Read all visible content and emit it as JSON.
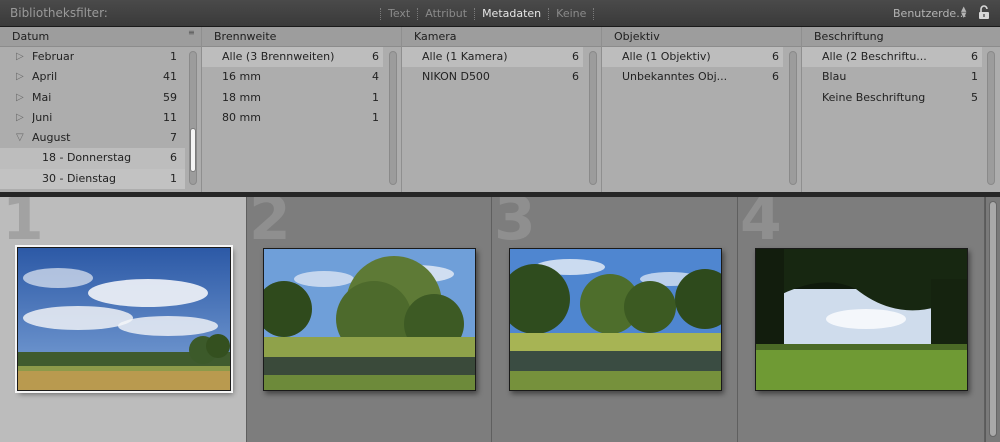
{
  "filterbar": {
    "title": "Bibliotheksfilter:",
    "modes": [
      {
        "label": "Text",
        "active": false
      },
      {
        "label": "Attribut",
        "active": false
      },
      {
        "label": "Metadaten",
        "active": true
      },
      {
        "label": "Keine",
        "active": false
      }
    ],
    "preset": "Benutzerde...",
    "lock_icon": "padlock-open-icon"
  },
  "columns": [
    {
      "header": "Datum",
      "rows": [
        {
          "label": "Februar",
          "count": "1",
          "expander": "collapsed"
        },
        {
          "label": "April",
          "count": "41",
          "expander": "collapsed"
        },
        {
          "label": "Mai",
          "count": "59",
          "expander": "collapsed"
        },
        {
          "label": "Juni",
          "count": "11",
          "expander": "collapsed"
        },
        {
          "label": "August",
          "count": "7",
          "expander": "expanded"
        },
        {
          "label": "18 - Donnerstag",
          "count": "6",
          "selected": true,
          "child": true
        },
        {
          "label": "30 - Dienstag",
          "count": "1",
          "child": true
        }
      ]
    },
    {
      "header": "Brennweite",
      "rows": [
        {
          "label": "Alle (3 Brennweiten)",
          "count": "6",
          "selected": true
        },
        {
          "label": "16 mm",
          "count": "4"
        },
        {
          "label": "18 mm",
          "count": "1"
        },
        {
          "label": "80 mm",
          "count": "1"
        }
      ]
    },
    {
      "header": "Kamera",
      "rows": [
        {
          "label": "Alle (1 Kamera)",
          "count": "6",
          "selected": true
        },
        {
          "label": "NIKON D500",
          "count": "6"
        }
      ]
    },
    {
      "header": "Objektiv",
      "rows": [
        {
          "label": "Alle (1 Objektiv)",
          "count": "6",
          "selected": true
        },
        {
          "label": "Unbekanntes Obj...",
          "count": "6"
        }
      ]
    },
    {
      "header": "Beschriftung",
      "rows": [
        {
          "label": "Alle (2 Beschriftu...",
          "count": "6",
          "selected": true
        },
        {
          "label": "Blau",
          "count": "1"
        },
        {
          "label": "Keine Beschriftung",
          "count": "5"
        }
      ]
    }
  ],
  "grid": {
    "cells": [
      {
        "number": "1",
        "selected": true,
        "photo": "field-sky"
      },
      {
        "number": "2",
        "selected": false,
        "photo": "willow-pond"
      },
      {
        "number": "3",
        "selected": false,
        "photo": "trees-pond"
      },
      {
        "number": "4",
        "selected": false,
        "photo": "meadow-shade"
      }
    ]
  },
  "colors": {
    "selected_cell": "#bcbcbc",
    "cell": "#7d7d7d",
    "panel": "#adadad"
  }
}
